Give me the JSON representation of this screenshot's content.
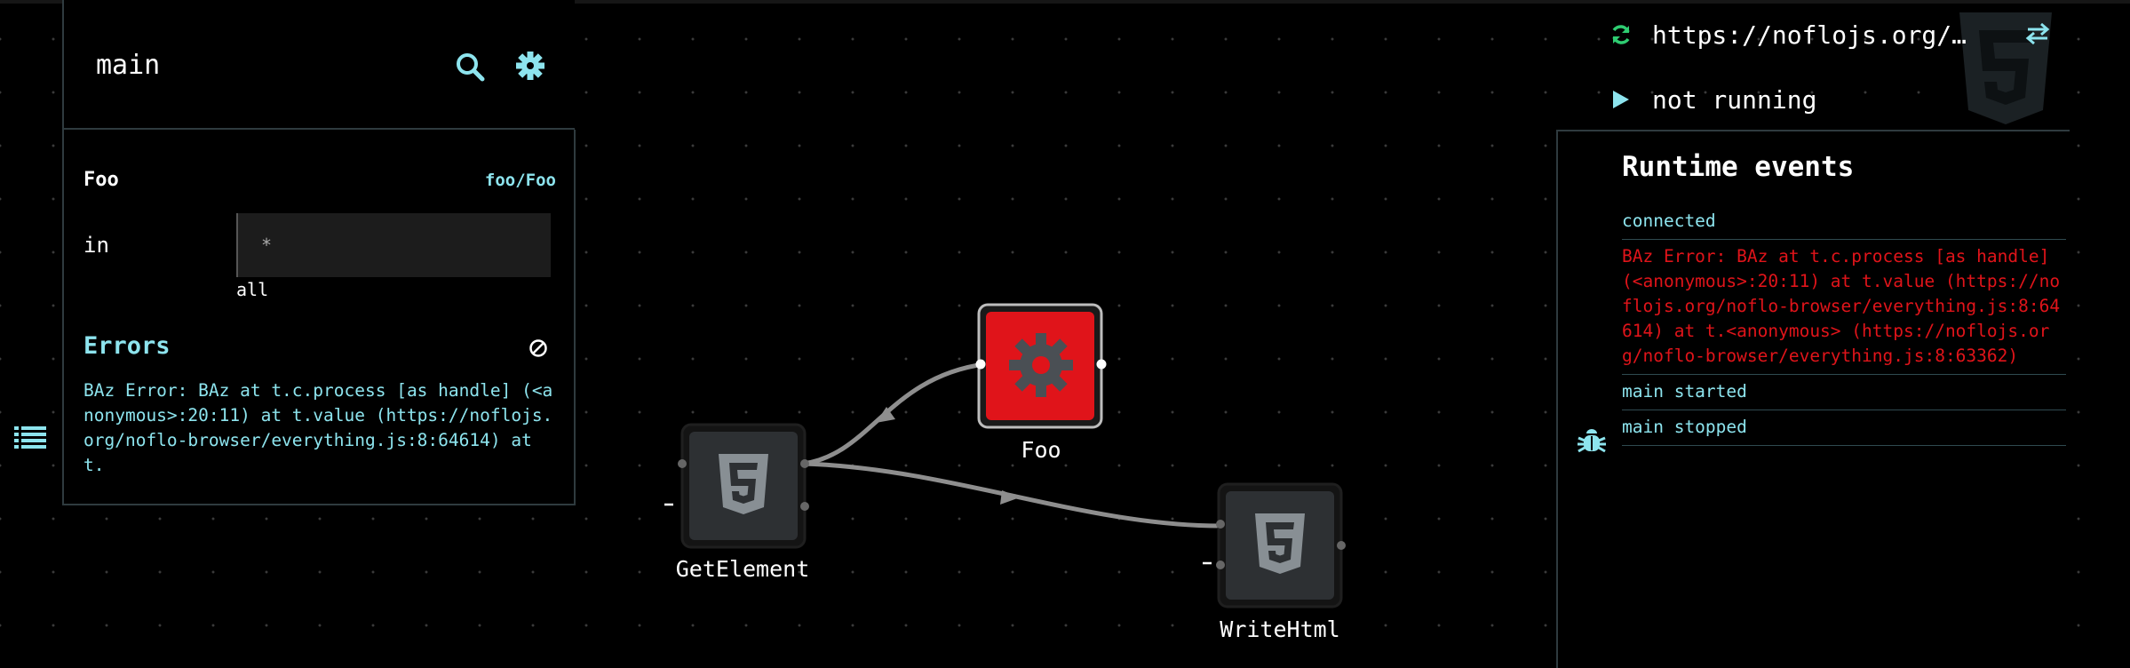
{
  "header": {
    "graph_name": "main"
  },
  "inspector": {
    "node_name": "Foo",
    "component": "foo/Foo",
    "port": {
      "name": "in",
      "placeholder": "*",
      "type": "all"
    },
    "errors_heading": "Errors",
    "error_message": "BAz Error: BAz at t.c.process [as handle] (<anonymous>:20:11) at t.value (https://noflojs.org/noflo-browser/everything.js:8:64614) at t."
  },
  "graph": {
    "nodes": [
      {
        "id": "getelement",
        "label": "GetElement",
        "icon": "html5-icon",
        "state": "normal"
      },
      {
        "id": "foo",
        "label": "Foo",
        "icon": "gear-icon",
        "state": "error"
      },
      {
        "id": "writehtml",
        "label": "WriteHtml",
        "icon": "html5-icon",
        "state": "normal"
      }
    ]
  },
  "runtime": {
    "url": "https://noflojs.org/…",
    "status": "not running"
  },
  "events": {
    "title": "Runtime events",
    "items": [
      {
        "text": "connected",
        "kind": "info"
      },
      {
        "text": "BAz Error: BAz at t.c.process [as handle] (<anonymous>:20:11) at t.value (https://noflojs.org/noflo-browser/everything.js:8:64614) at t.<anonymous> (https://noflojs.org/noflo-browser/everything.js:8:63362)",
        "kind": "error"
      },
      {
        "text": "main started",
        "kind": "info"
      },
      {
        "text": "main stopped",
        "kind": "info"
      }
    ]
  },
  "colors": {
    "accent": "#8de4ee",
    "error": "#e0141a",
    "node_fill": "#2d3033",
    "icon_green": "#2ecc71"
  }
}
